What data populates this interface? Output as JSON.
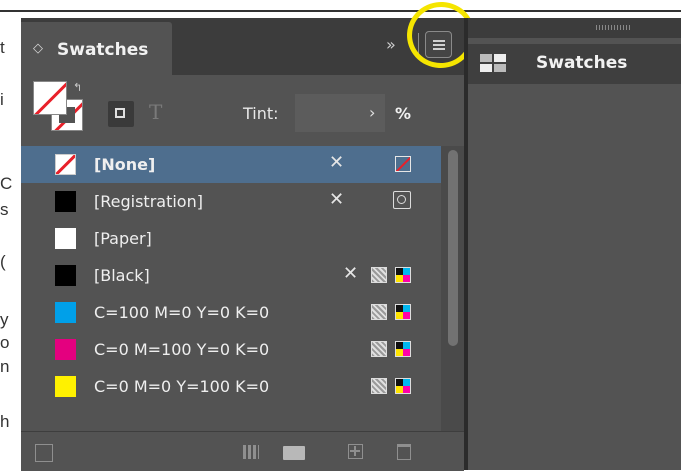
{
  "document_bg": {
    "letters": [
      "t",
      "i",
      "",
      "",
      "C",
      "s",
      "",
      "(",
      "",
      "y",
      "o",
      "n",
      "",
      "h"
    ]
  },
  "panel": {
    "tab_label": "Swatches",
    "tab_chevron": "◇",
    "collapse_glyph": "»",
    "tint_label": "Tint:",
    "tint_value": "",
    "tint_arrow": "›",
    "tint_unit": "%",
    "text_toggle": "T",
    "swatches": [
      {
        "name": "[None]",
        "chip": "none",
        "locked": true,
        "type": "none",
        "selected": true
      },
      {
        "name": "[Registration]",
        "chip": "#000000",
        "locked": true,
        "type": "registration",
        "selected": false
      },
      {
        "name": "[Paper]",
        "chip": "#ffffff",
        "locked": false,
        "type": "",
        "selected": false
      },
      {
        "name": "[Black]",
        "chip": "#000000",
        "locked": true,
        "type": "process-cmyk",
        "selected": false
      },
      {
        "name": "C=100 M=0 Y=0 K=0",
        "chip": "#00a0e9",
        "locked": false,
        "type": "process-cmyk",
        "selected": false
      },
      {
        "name": "C=0 M=100 Y=0 K=0",
        "chip": "#e4007f",
        "locked": false,
        "type": "process-cmyk",
        "selected": false
      },
      {
        "name": "C=0 M=0 Y=100 K=0",
        "chip": "#fff100",
        "locked": false,
        "type": "process-cmyk",
        "selected": false
      }
    ],
    "icons": {
      "lock": "no-edit-icon",
      "none_type": "none-swatch-icon",
      "registration": "registration-icon",
      "process": "process-color-icon",
      "cmyk": "cmyk-mode-icon"
    }
  },
  "side_panel": {
    "tab_label": "Swatches"
  },
  "colors": {
    "panel_bg": "#535353",
    "selection": "#4e6e8e",
    "annotation": "#f5e500",
    "none_red": "#e8202a"
  }
}
